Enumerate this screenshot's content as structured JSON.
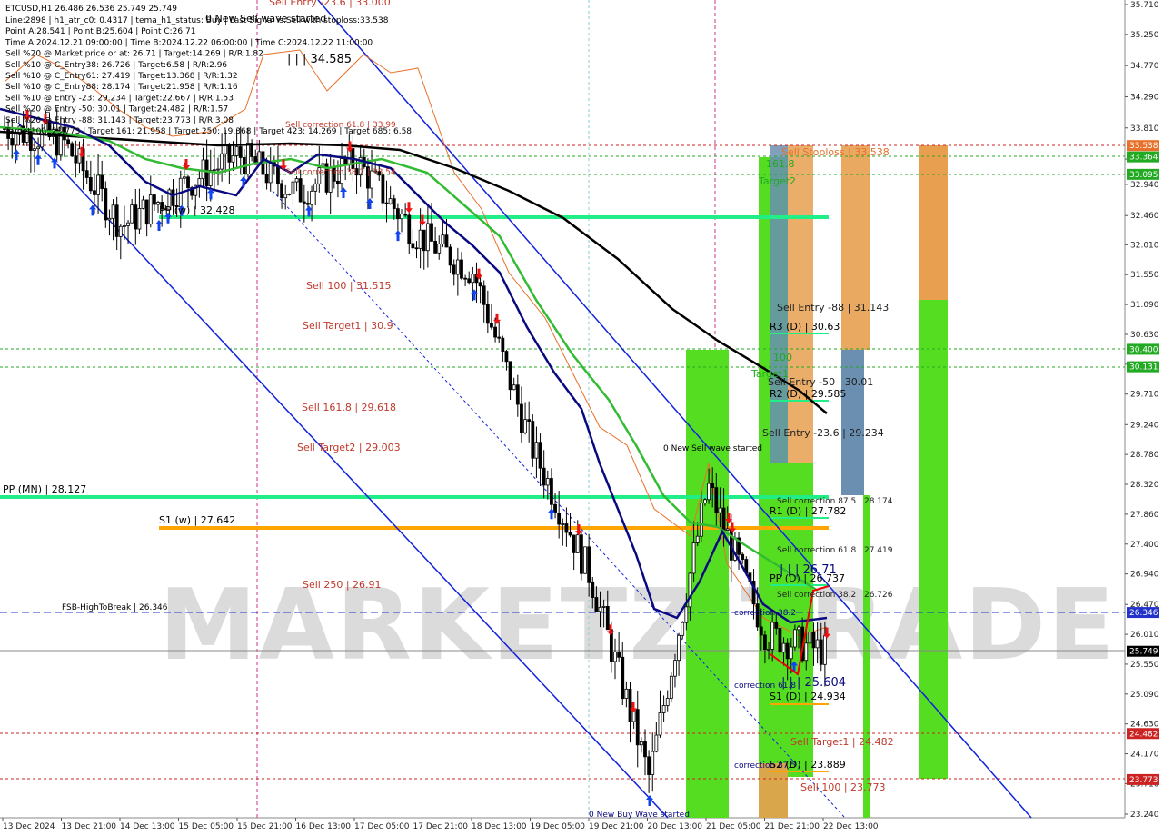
{
  "symbol_title": "ETCUSD,H1  26.486 26.536 25.749 25.749",
  "info_lines": [
    "Line:2898 | h1_atr_c0: 0.4317 | tema_h1_status: Buy | Last Signal is:Sell with stoploss:33.538",
    "Point A:28.541 | Point B:25.604 | Point C:26.71",
    "Time A:2024.12.21 09:00:00 | Time B:2024.12.22 06:00:00 | Time C:2024.12.22 11:00:00",
    "Sell %20 @ Market price or at: 26.71 | Target:14.269 | R/R:1.82",
    "Sell %10 @ C_Entry38: 26.726 | Target:6.58 | R/R:2.96",
    "Sell %10 @ C_Entry61: 27.419 | Target:13.368 | R/R:1.32",
    "Sell %10 @ C_Entry88: 28.174 | Target:21.958 | R/R:1.16",
    "Sell %10 @ Entry -23: 29.234 | Target:22.667 | R/R:1.53",
    "Sell %20 @ Entry -50: 30.01 | Target:24.482 | R/R:1.57",
    "Sell %20 @ Entry -88: 31.143 | Target:23.773 | R/R:3.08",
    "Target100: 23.773 | Target 161: 21.958 | Target 250: 19.368 | Target 423: 14.269 | Target 685: 6.58"
  ],
  "watermark": "MARKETZITRADE",
  "price_axis": [
    "35.710",
    "35.250",
    "34.770",
    "34.290",
    "33.810",
    "33.330",
    "32.940",
    "32.460",
    "32.010",
    "31.550",
    "31.090",
    "30.630",
    "30.170",
    "29.710",
    "29.240",
    "28.780",
    "28.320",
    "27.860",
    "27.400",
    "26.940",
    "26.470",
    "26.010",
    "25.550",
    "25.090",
    "24.630",
    "24.170",
    "23.710",
    "23.240"
  ],
  "price_badges": [
    {
      "text": "33.538",
      "color": "#e8702a"
    },
    {
      "text": "33.364",
      "color": "#22aa22"
    },
    {
      "text": "33.095",
      "color": "#22aa22"
    },
    {
      "text": "30.400",
      "color": "#22aa22"
    },
    {
      "text": "30.131",
      "color": "#22aa22"
    },
    {
      "text": "26.346",
      "color": "#2233cc"
    },
    {
      "text": "25.749",
      "color": "#000000"
    },
    {
      "text": "24.482",
      "color": "#cc2222"
    },
    {
      "text": "23.773",
      "color": "#cc2222"
    }
  ],
  "time_axis": [
    "13 Dec 2024",
    "13 Dec 21:00",
    "14 Dec 13:00",
    "15 Dec 05:00",
    "15 Dec 21:00",
    "16 Dec 13:00",
    "17 Dec 05:00",
    "17 Dec 21:00",
    "18 Dec 13:00",
    "19 Dec 05:00",
    "19 Dec 21:00",
    "20 Dec 13:00",
    "21 Dec 05:00",
    "21 Dec 21:00",
    "22 Dec 13:00"
  ],
  "chart_labels": {
    "top_sell_entry": "Sell Entry -23.6 | 33.000",
    "new_sell_wave_top": "0 New Sell wave started",
    "peak_34": "| | | 34.585",
    "sell_correction_top": "Sell correction 61.8 | 33.99",
    "sell_correction_mid": "Sell correction 38.2 | 33.54",
    "sell_100": "Sell 100 | 31.515",
    "sell_target1": "Sell Target1 | 30.9",
    "sell_161": "Sell 161.8 | 29.618",
    "sell_target2": "Sell Target2 | 29.003",
    "sell_250": "Sell  250 | 26.91",
    "pp_w": "PP (w) | 32.428",
    "pp_mn": "PP (MN) | 28.127",
    "s1_w": "S1 (w) | 27.642",
    "fsb": "FSB-HighToBreak | 26.346",
    "new_sell_wave_mid": "0 New Sell wave started",
    "new_buy_wave": "0 New Buy Wave started",
    "sell_stoploss": "Sell Stoploss | 33.538",
    "lvl_161": "161.8",
    "target2": "Target2",
    "sell_entry_88": "Sell Entry -88 | 31.143",
    "r3_d": "R3 (D) | 30.63",
    "lvl_100": "100",
    "target1": "Target1",
    "sell_entry_50": "Sell Entry -50 | 30.01",
    "r2_d": "R2 (D) | 29.585",
    "sell_entry_23": "Sell Entry -23.6 | 29.234",
    "sell_corr_875": "Sell correction 87.5 | 28.174",
    "r1_d": "R1 (D) | 27.782",
    "sell_corr_618": "Sell correction 61.8 | 27.419",
    "pt_c": "| | | 26.71",
    "pp_d": "PP (D) | 26.737",
    "sell_corr_382": "Sell correction 38.2 | 26.726",
    "pt_b": "| | | 25.604",
    "s1_d": "S1 (D) | 24.934",
    "sell_target1_r": "Sell Target1 | 24.482",
    "s2_d": "S2 (D) | 23.889",
    "sell_100_r": "Sell 100 | 23.773",
    "correction_a": "correction 38.2",
    "correction_b": "correction 61.8",
    "correction_c": "correction 87.5",
    "pp_w_short": "PP (w)"
  },
  "colors": {
    "bull_bear": "#000000",
    "tema": "#0a0a80",
    "ma_green": "#33bb33",
    "ma_black": "#000000",
    "channel": "#1122dd",
    "pivot_green": "#22ee88",
    "s1_orange": "#ffa500",
    "fib_red": "#c0392b",
    "zone_green": "#55dd22",
    "zone_orange": "#e8a050",
    "zone_steel": "#6a8fb0"
  },
  "chart_data": {
    "type": "candlestick",
    "symbol": "ETCUSD",
    "timeframe": "H1",
    "ohlc_last": {
      "open": 26.486,
      "high": 26.536,
      "low": 25.749,
      "close": 25.749
    },
    "ylim": [
      23.24,
      35.71
    ],
    "price_path": [
      {
        "t": "13 Dec 2024",
        "p": 33.8
      },
      {
        "t": "13 Dec 21:00",
        "p": 33.6
      },
      {
        "t": "14 Dec 13:00",
        "p": 32.3
      },
      {
        "t": "15 Dec 05:00",
        "p": 32.9
      },
      {
        "t": "15 Dec 21:00",
        "p": 33.4
      },
      {
        "t": "16 Dec 13:00",
        "p": 32.8
      },
      {
        "t": "17 Dec 05:00",
        "p": 33.3
      },
      {
        "t": "17 Dec 21:00",
        "p": 32.2
      },
      {
        "t": "18 Dec 13:00",
        "p": 31.6
      },
      {
        "t": "19 Dec 05:00",
        "p": 28.9
      },
      {
        "t": "19 Dec 21:00",
        "p": 26.9
      },
      {
        "t": "20 Dec 13:00",
        "p": 23.8
      },
      {
        "t": "21 Dec 05:00",
        "p": 28.3
      },
      {
        "t": "21 Dec 21:00",
        "p": 26.0
      },
      {
        "t": "22 Dec 13:00",
        "p": 25.75
      }
    ],
    "levels": {
      "sell_stoploss": 33.538,
      "pp_w": 32.428,
      "pp_mn": 28.127,
      "s1_w": 27.642,
      "fsb_high_to_break": 26.346,
      "r3_d": 30.63,
      "r2_d": 29.585,
      "r1_d": 27.782,
      "pp_d": 26.737,
      "s1_d": 24.934,
      "s2_d": 23.889,
      "sell_target1": 24.482,
      "sell_100": 23.773,
      "last_close": 25.749
    }
  }
}
